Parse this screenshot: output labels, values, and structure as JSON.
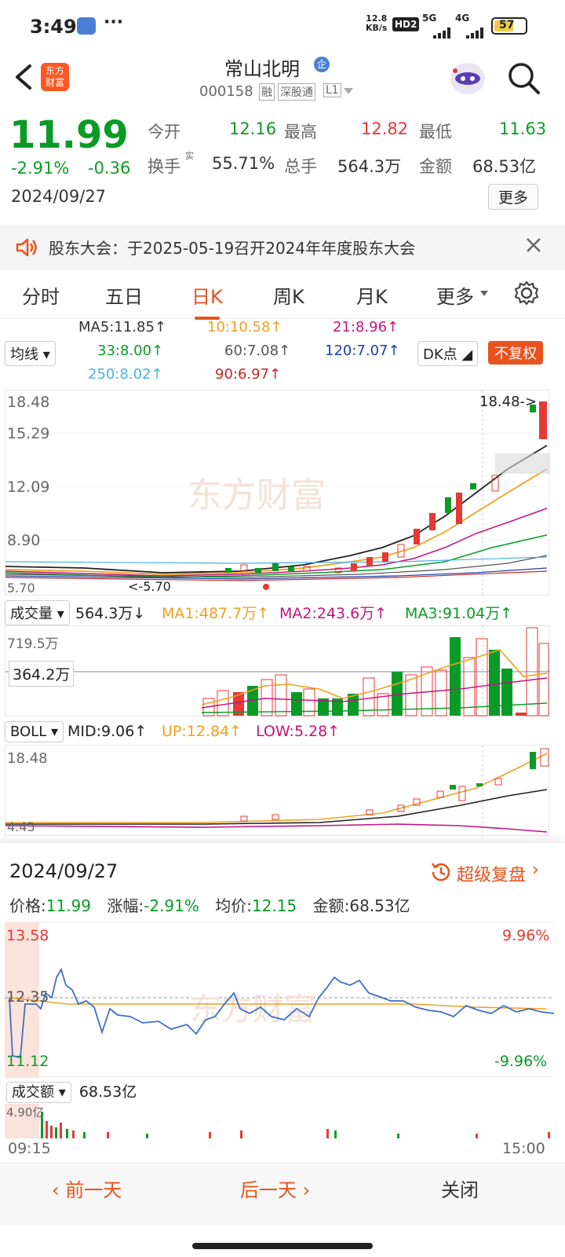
{
  "status_bar": {
    "time": "3:49",
    "dots": "···",
    "net_speed": "12.8",
    "net_unit": "KB/s",
    "hd": "HD2",
    "signal1": "5G",
    "signal2": "4G",
    "battery": "57"
  },
  "header": {
    "logo_top": "东方",
    "logo_bottom": "财富",
    "title": "常山北明",
    "title_badge": "企",
    "code": "000158",
    "tag_rong": "融",
    "tag_sgt": "深股通",
    "tag_l1": "L1"
  },
  "quote": {
    "price": "11.99",
    "change_pct": "-2.91%",
    "change": "-0.36",
    "date": "2024/09/27",
    "open_label": "今开",
    "open": "12.16",
    "high_label": "最高",
    "high": "12.82",
    "low_label": "最低",
    "low": "11.63",
    "turnover_label": "换手",
    "turnover_sup": "实",
    "turnover": "55.71%",
    "volume_label": "总手",
    "volume": "564.3万",
    "amount_label": "金额",
    "amount": "68.53亿",
    "more": "更多"
  },
  "notice": {
    "text": "股东大会：于2025-05-19召开2024年年度股东大会"
  },
  "tabs": [
    "分时",
    "五日",
    "日K",
    "周K",
    "月K",
    "更多"
  ],
  "ma": {
    "selector": "均线",
    "ma5": "MA5:11.85",
    "ma10": "10:10.58",
    "ma21": "21:8.96",
    "ma33": "33:8.00",
    "ma60": "60:7.08",
    "ma120": "120:7.07",
    "ma250": "250:8.02",
    "ma90": "90:6.97",
    "dk": "DK点",
    "fuquan": "不复权"
  },
  "kline": {
    "y_labels": [
      "18.48",
      "15.29",
      "12.09",
      "8.90",
      "5.70"
    ],
    "high_marker": "18.48",
    "low_marker": "5.70",
    "watermark": "东方财富"
  },
  "volume": {
    "label": "成交量",
    "value": "564.3万",
    "ma1": "MA1:487.7万",
    "ma2": "MA2:243.6万",
    "ma3": "MA3:91.04万",
    "y_top": "719.5万",
    "y_mid": "364.2万"
  },
  "boll": {
    "label": "BOLL",
    "mid": "MID:9.06",
    "up": "UP:12.84",
    "low": "LOW:5.28",
    "y_top": "18.48",
    "y_bottom": "4.43"
  },
  "replay": {
    "date": "2024/09/27",
    "super_replay": "超级复盘",
    "price_label": "价格:",
    "price": "11.99",
    "chg_label": "涨幅:",
    "chg": "-2.91%",
    "avg_label": "均价:",
    "avg": "12.15",
    "amt_label": "金额:",
    "amt": "68.53亿"
  },
  "intraday": {
    "y_top": "13.58",
    "y_mid": "12.35",
    "y_bottom": "11.12",
    "pct_top": "9.96%",
    "pct_bottom": "-9.96%",
    "amount_label": "成交额",
    "amount_value": "68.53亿",
    "amount_y_top": "4.90亿",
    "time_start": "09:15",
    "time_end": "15:00",
    "watermark": "东方财富"
  },
  "bottom_nav": {
    "prev": "前一天",
    "next": "后一天",
    "close": "关闭"
  },
  "colors": {
    "up": "#e53935",
    "down": "#0a9b27",
    "accent": "#e8531e"
  }
}
